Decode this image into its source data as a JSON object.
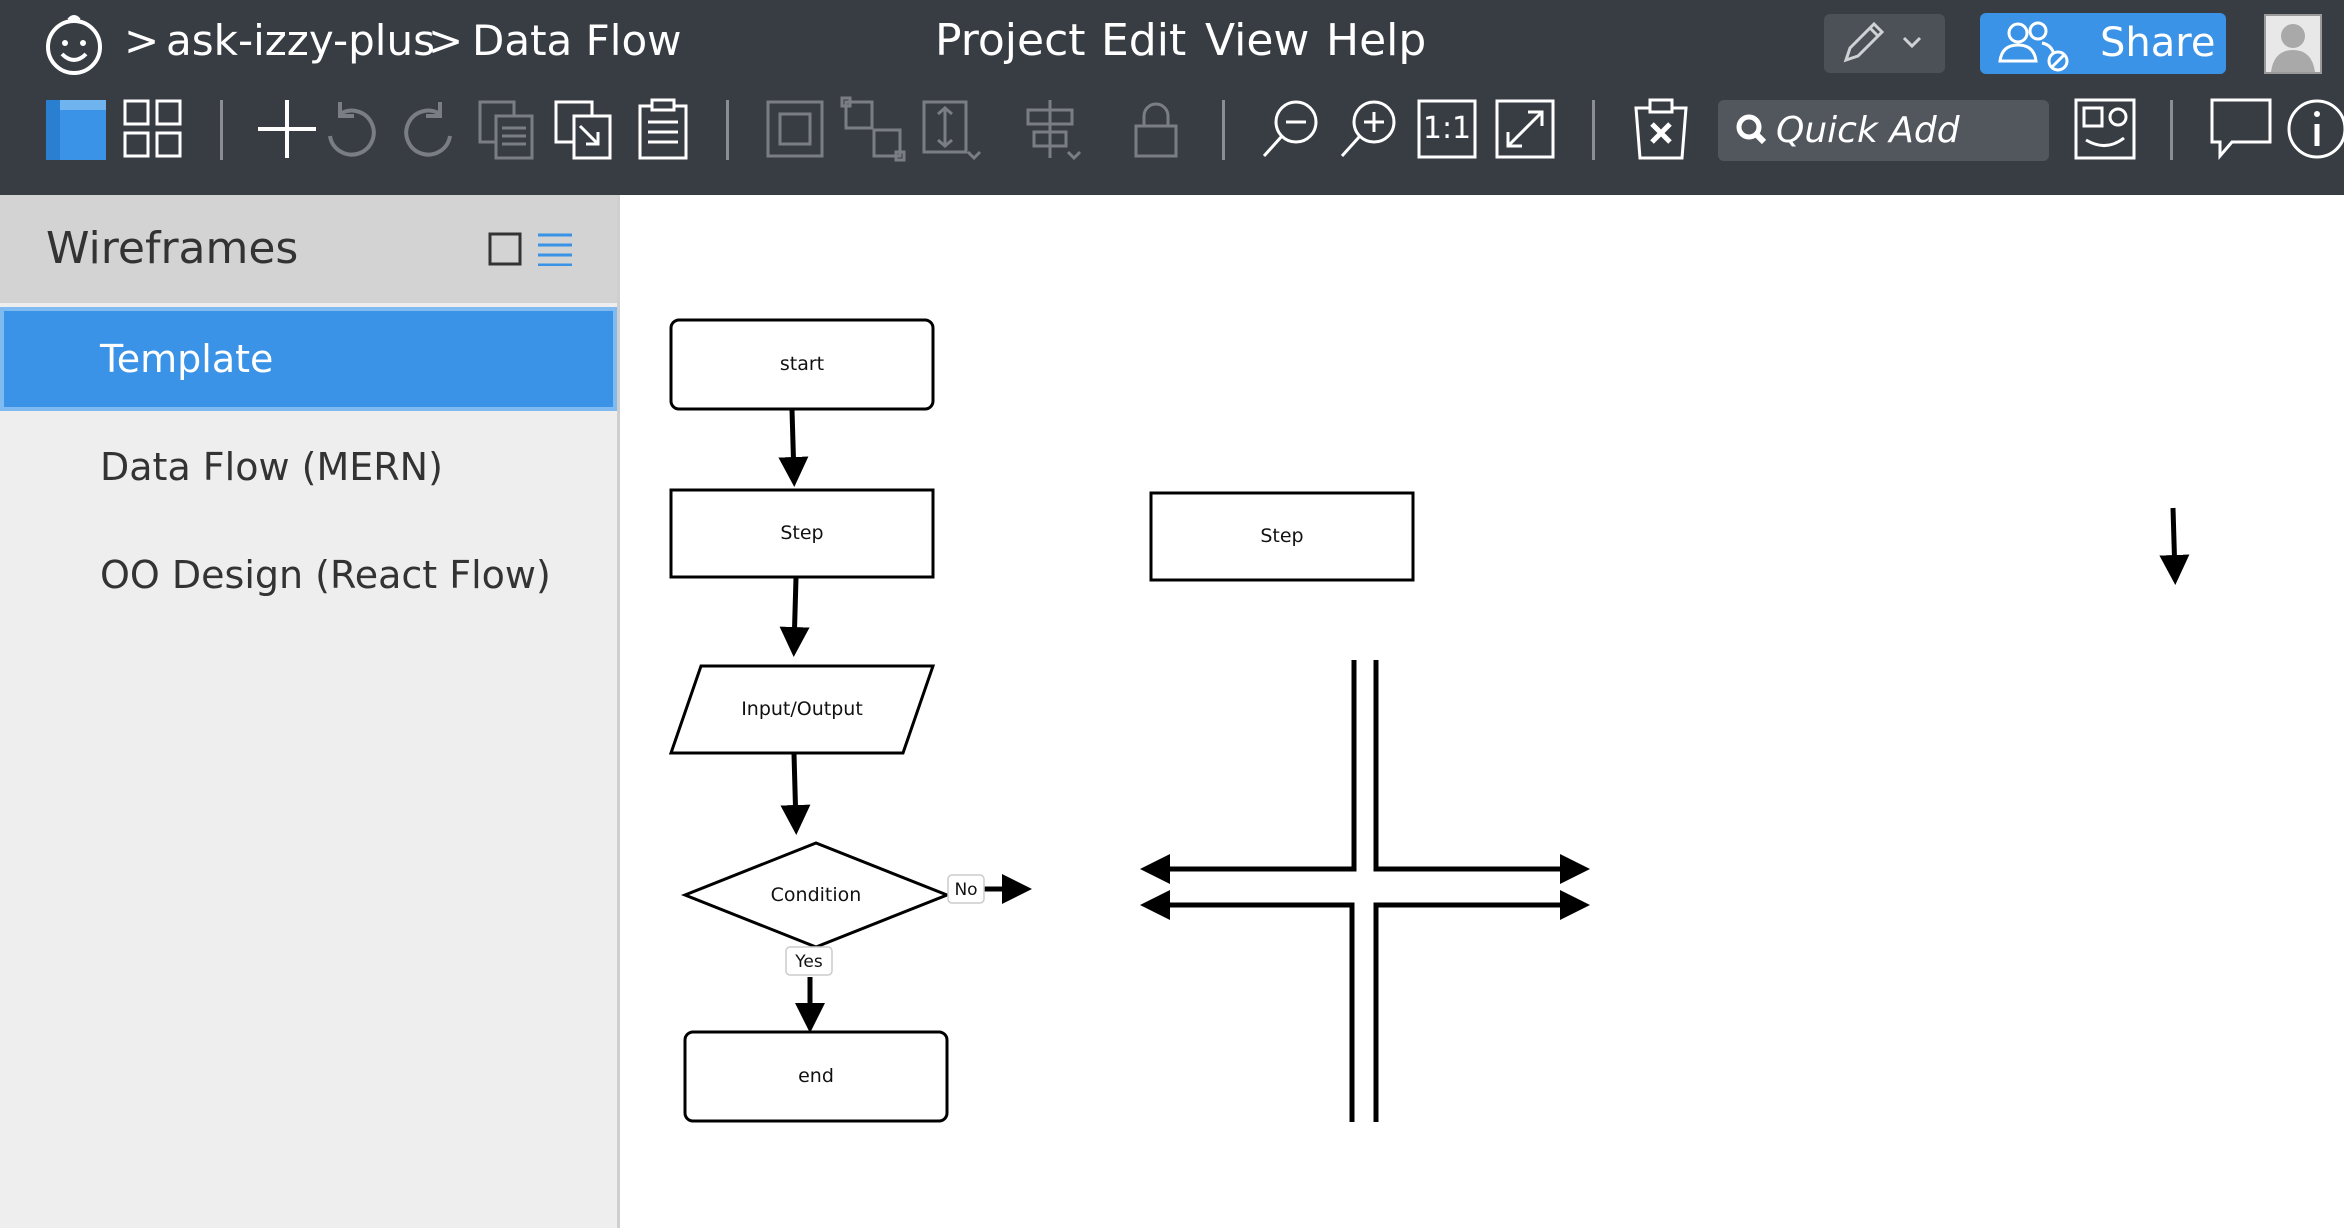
{
  "header": {
    "breadcrumb_sep1": ">",
    "project_name": "ask-izzy-plus",
    "breadcrumb_sep2": ">",
    "page_name": "Data Flow",
    "menu": [
      "Project",
      "Edit",
      "View",
      "Help"
    ],
    "share_label": "Share",
    "quick_add_placeholder": "Quick Add"
  },
  "toolbar": {
    "icons": [
      "single-view-icon",
      "grid-view-icon",
      "add-icon",
      "undo-icon",
      "redo-icon",
      "copy-icon",
      "paste-into-icon",
      "clipboard-icon",
      "group-icon",
      "ungroup-icon",
      "resize-icon",
      "align-icon",
      "lock-icon",
      "zoom-out-icon",
      "zoom-in-icon",
      "actual-size-icon",
      "fullscreen-icon",
      "clear-clipboard-icon",
      "quick-add-search-icon",
      "media-library-icon",
      "comment-icon",
      "info-icon"
    ],
    "actual_size_label": "1:1"
  },
  "sidebar": {
    "title": "Wireframes",
    "items": [
      {
        "label": "Template",
        "active": true
      },
      {
        "label": "Data Flow (MERN)",
        "active": false
      },
      {
        "label": "OO Design (React Flow)",
        "active": false
      }
    ]
  },
  "diagram": {
    "start": "start",
    "step1": "Step",
    "step2": "Step",
    "io": "Input/Output",
    "condition": "Condition",
    "no_label": "No",
    "yes_label": "Yes",
    "end": "end"
  },
  "colors": {
    "topbar": "#383d44",
    "accent": "#3a93e6",
    "sidebar_bg": "#eeeeee",
    "sidebar_header": "#d3d3d3"
  }
}
